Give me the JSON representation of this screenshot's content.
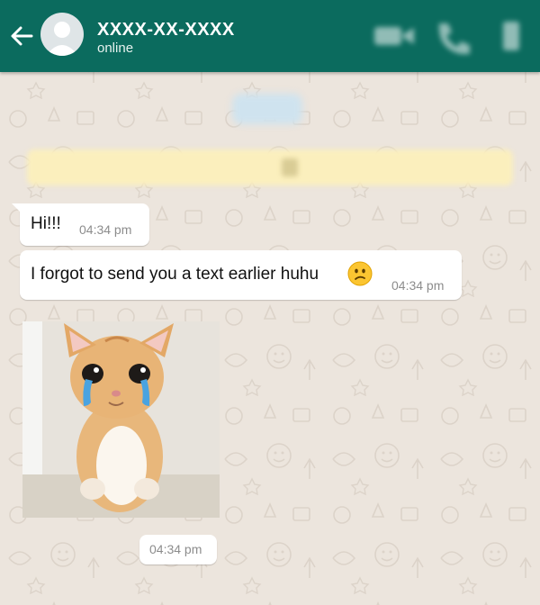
{
  "header": {
    "contact_name": "XXXX-XX-XXXX",
    "status": "online",
    "icons": [
      "back-arrow-icon",
      "avatar-placeholder-icon",
      "video-call-icon",
      "voice-call-icon",
      "more-menu-icon"
    ]
  },
  "messages": [
    {
      "type": "text",
      "text": "Hi!!!",
      "time": "04:34 pm"
    },
    {
      "type": "text",
      "text": "I forgot to send you a text earlier huhu",
      "emoji": "confused-face-emoji",
      "time": "04:34 pm"
    },
    {
      "type": "image",
      "image": "crying-kitten-photo",
      "time": "04:34 pm"
    }
  ],
  "colors": {
    "header": "#0b6b5e",
    "wallpaper": "#ece5dd",
    "bubble": "#ffffff",
    "timestamp": "#8c8c8c",
    "notice": "#fbefbd",
    "date_chip": "#cfe3ef"
  }
}
